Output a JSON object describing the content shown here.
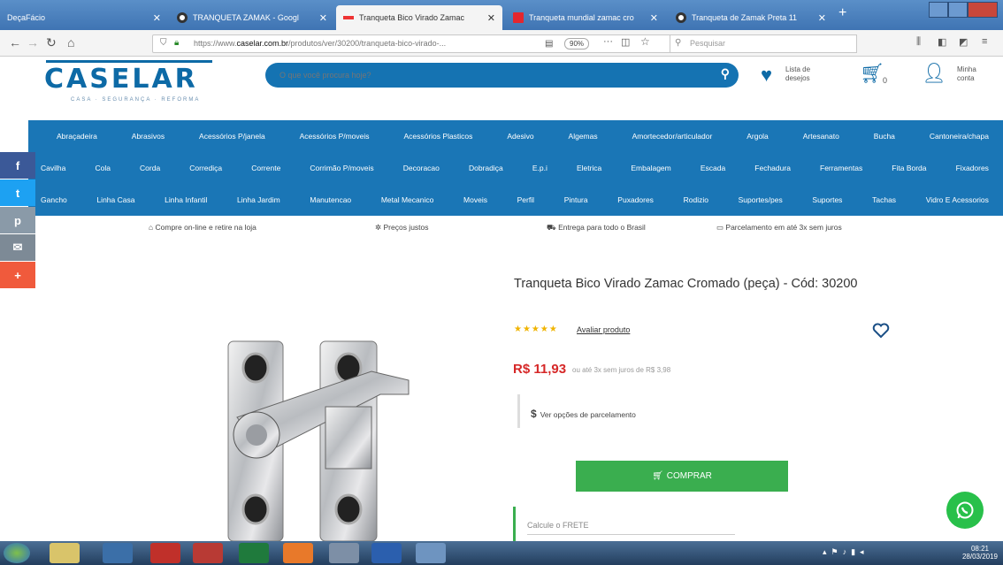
{
  "browser": {
    "tabs": [
      {
        "title": "DeçaFácio",
        "active": false
      },
      {
        "title": "TRANQUETA ZAMAK - Googl",
        "active": false
      },
      {
        "title": "Tranqueta Bico Virado Zamac",
        "active": true
      },
      {
        "title": "Tranqueta mundial zamac cro",
        "active": false
      },
      {
        "title": "Tranqueta de Zamak Preta 11",
        "active": false
      }
    ],
    "new_tab": "+",
    "url_prefix": "https://www.",
    "url_domain": "caselar.com.br",
    "url_path": "/produtos/ver/30200/tranqueta-bico-virado-...",
    "zoom": "90%",
    "search_placeholder": "Pesquisar"
  },
  "site": {
    "logo": "CASELAR",
    "tagline": "CASA · SEGURANÇA · REFORMA",
    "search_placeholder": "O que você procura hoje?",
    "wishlist_label_1": "Lista de",
    "wishlist_label_2": "desejos",
    "cart_count": "0",
    "account_label_1": "Minha",
    "account_label_2": "conta"
  },
  "menu": {
    "row1": [
      "Abraçadeira",
      "Abrasivos",
      "Acessórios P/janela",
      "Acessórios P/moveis",
      "Acessórios Plasticos",
      "Adesivo",
      "Algemas",
      "Amortecedor/articulador",
      "Argola",
      "Artesanato",
      "Bucha",
      "Cantoneira/chapa"
    ],
    "row2": [
      "Cavilha",
      "Cola",
      "Corda",
      "Corrediça",
      "Corrente",
      "Corrimão P/moveis",
      "Decoracao",
      "Dobradiça",
      "E.p.i",
      "Eletrica",
      "Embalagem",
      "Escada",
      "Fechadura",
      "Ferramentas",
      "Fita Borda",
      "Fixadores"
    ],
    "row3": [
      "Gancho",
      "Linha Casa",
      "Linha Infantil",
      "Linha Jardim",
      "Manutencao",
      "Metal Mecanico",
      "Moveis",
      "Perfil",
      "Pintura",
      "Puxadores",
      "Rodizio",
      "Suportes/pes",
      "Suportes",
      "Tachas",
      "Vidro E Acessorios"
    ]
  },
  "social": [
    {
      "name": "facebook",
      "glyph": "f",
      "color": "#3b5998"
    },
    {
      "name": "twitter",
      "glyph": "t",
      "color": "#1da1f2"
    },
    {
      "name": "pinterest",
      "glyph": "p",
      "color": "#8a9aa8"
    },
    {
      "name": "email",
      "glyph": "✉",
      "color": "#7d8a96"
    },
    {
      "name": "more",
      "glyph": "+",
      "color": "#f05a3c"
    }
  ],
  "benefits": [
    "Compre on-line e retire na loja",
    "Preços justos",
    "Entrega para todo o Brasil",
    "Parcelamento em até 3x sem juros"
  ],
  "product": {
    "title": "Tranqueta Bico Virado Zamac Cromado (peça) - Cód: 30200",
    "stars": "★★★★★",
    "rate_link": "Avaliar produto",
    "price": "R$ 11,93",
    "price_note": "ou até 3x sem juros de R$ 3,98",
    "install_symbol": "$",
    "install_text": "Ver opções de parcelamento",
    "buy_label": "COMPRAR",
    "freight_label": "Calcule o FRETE"
  },
  "taskbar": {
    "time": "08:21",
    "date": "28/03/2019"
  }
}
